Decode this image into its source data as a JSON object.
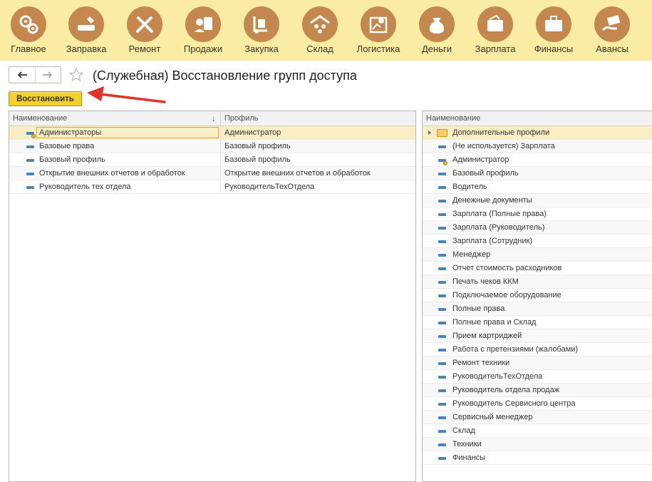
{
  "menu": [
    {
      "label": "Главное",
      "icon": "gears-icon"
    },
    {
      "label": "Заправка",
      "icon": "toner-refill-icon"
    },
    {
      "label": "Ремонт",
      "icon": "tools-icon"
    },
    {
      "label": "Продажи",
      "icon": "sale-icon"
    },
    {
      "label": "Закупка",
      "icon": "hand-truck-icon"
    },
    {
      "label": "Склад",
      "icon": "warehouse-icon"
    },
    {
      "label": "Логистика",
      "icon": "map-route-icon"
    },
    {
      "label": "Деньги",
      "icon": "money-bag-icon"
    },
    {
      "label": "Зарплата",
      "icon": "wallet-icon"
    },
    {
      "label": "Финансы",
      "icon": "briefcase-icon"
    },
    {
      "label": "Авансы",
      "icon": "cash-hand-icon"
    }
  ],
  "page": {
    "title": "(Служебная) Восстановление групп доступа",
    "restore_button": "Восстановить"
  },
  "left_table": {
    "headers": {
      "name": "Наименование",
      "profile": "Профиль",
      "sort": "↓"
    },
    "rows": [
      {
        "name": "Администраторы",
        "profile": "Администратор"
      },
      {
        "name": "Базовые права",
        "profile": "Базовый профиль"
      },
      {
        "name": "Базовый профиль",
        "profile": "Базовый профиль"
      },
      {
        "name": "Открытие внешних отчетов и обработок",
        "profile": "Открытие внешних отчетов и обработок"
      },
      {
        "name": "Руководитель тех отдела",
        "profile": "РуководительТехОтдела"
      }
    ]
  },
  "right_table": {
    "header": "Наименование",
    "rows": [
      "Дополнительные профили",
      "(Не используется) Зарплата",
      "Администратор",
      "Базовый профиль",
      "Водитель",
      "Денежные документы",
      "Зарплата (Полные права)",
      "Зарплата (Руководитель)",
      "Зарплата (Сотрудник)",
      "Менеджер",
      "Отчет стоимость расходников",
      "Печать чеков ККМ",
      "Подключаемое оборудование",
      "Полные права",
      "Полные права и Склад",
      "Прием картриджей",
      "Работа с претензиями (жалобами)",
      "Ремонт техники",
      "РуководительТехОтдела",
      "Руководитель отдела продаж",
      "Руководитель Сервисного центра",
      "Сервисный менеджер",
      "Склад",
      "Техники",
      "Финансы"
    ]
  },
  "colors": {
    "menubar": "#fbeca4",
    "icon_circle": "#c4874d",
    "restore_button": "#f5d02b",
    "arrow": "#e0322b"
  }
}
